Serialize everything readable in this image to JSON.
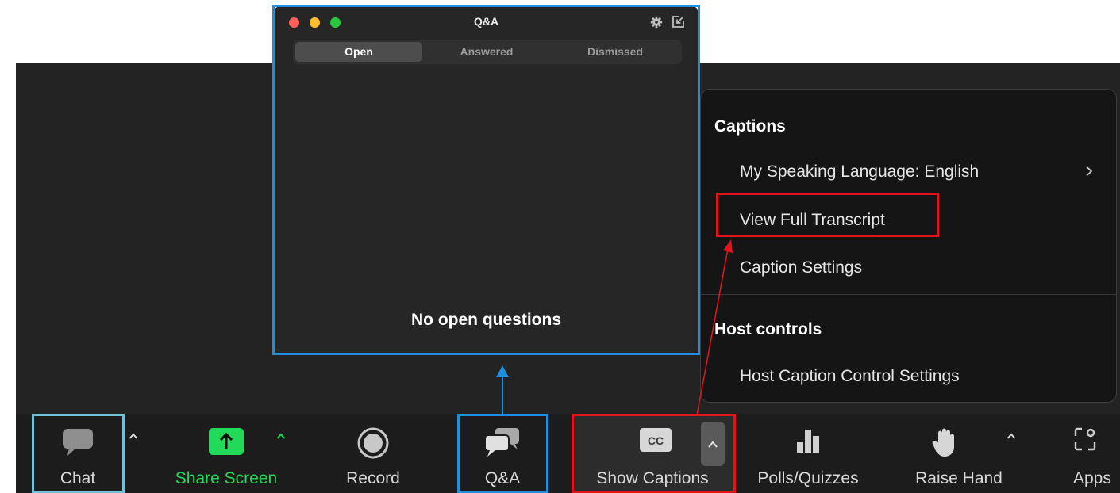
{
  "qa_window": {
    "title": "Q&A",
    "tabs": [
      {
        "label": "Open",
        "active": true
      },
      {
        "label": "Answered",
        "active": false
      },
      {
        "label": "Dismissed",
        "active": false
      }
    ],
    "empty_message": "No open questions",
    "traffic_lights": [
      "#ff5f57",
      "#febc2e",
      "#28c840"
    ],
    "icons": [
      "gear-icon",
      "pop-in-icon"
    ]
  },
  "captions_menu": {
    "captions_heading": "Captions",
    "speaking_language": "My Speaking Language: English",
    "view_transcript": "View Full Transcript",
    "caption_settings": "Caption Settings",
    "host_heading": "Host controls",
    "host_caption_settings": "Host Caption Control Settings",
    "submenu_icon": "chevron-right-icon"
  },
  "toolbar": {
    "chat": "Chat",
    "share_screen": "Share Screen",
    "record": "Record",
    "qa": "Q&A",
    "show_captions": "Show Captions",
    "cc_badge": "CC",
    "polls": "Polls/Quizzes",
    "raise_hand": "Raise Hand",
    "apps": "Apps"
  },
  "colors": {
    "share_green": "#23d959",
    "highlight_blue": "#1e8fdc",
    "highlight_red": "#e1131b",
    "highlight_cyan": "#72c2d6"
  }
}
